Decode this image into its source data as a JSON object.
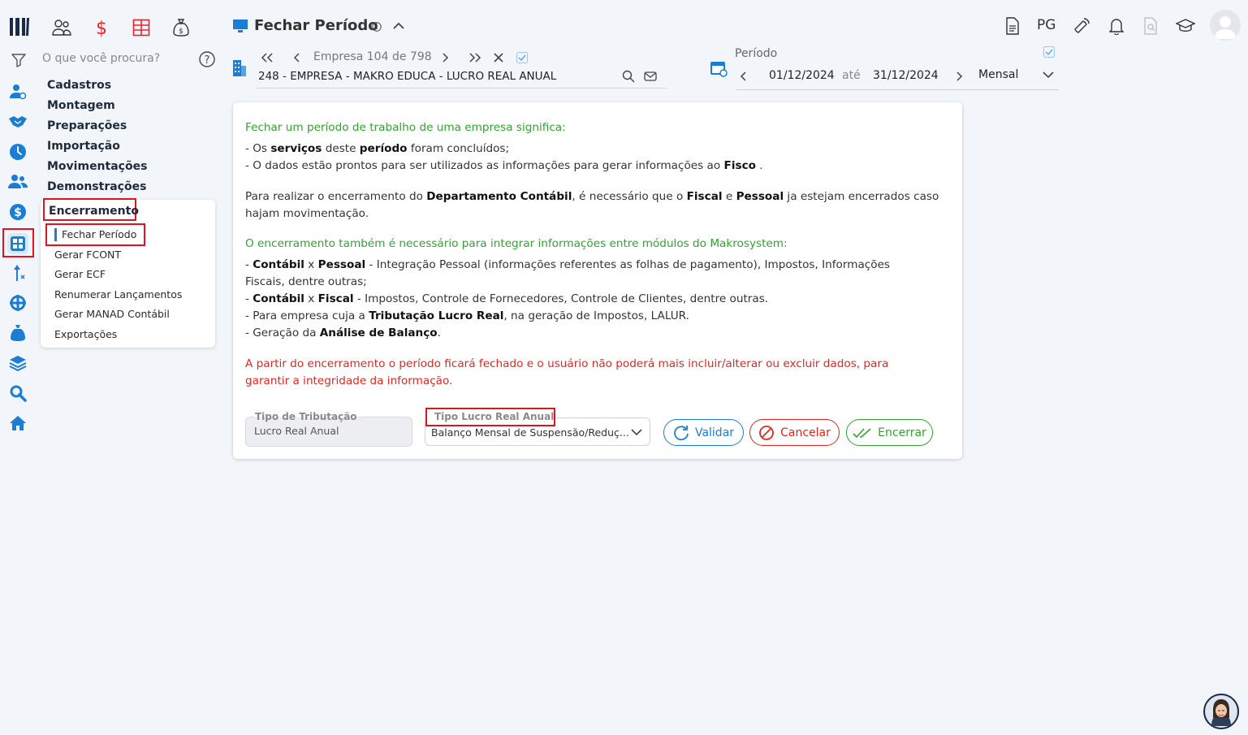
{
  "search": {
    "placeholder": "O que você procura?"
  },
  "header": {
    "title": "Fechar Período",
    "right_text": "PG"
  },
  "company": {
    "prefix": "Empresa",
    "current": "104",
    "of": "de",
    "total": "798",
    "name": "248 - EMPRESA - MAKRO EDUCA - LUCRO REAL ANUAL"
  },
  "period": {
    "label": "Período",
    "start": "01/12/2024",
    "between": "até",
    "end": "31/12/2024",
    "mode": "Mensal"
  },
  "menu": {
    "items": [
      "Cadastros",
      "Montagem",
      "Preparações",
      "Importação",
      "Movimentações",
      "Demonstrações"
    ],
    "group": "Encerramento",
    "subitems": [
      "Fechar Período",
      "Gerar FCONT",
      "Gerar ECF",
      "Renumerar Lançamentos",
      "Gerar MANAD Contábil",
      "Exportações"
    ]
  },
  "content": {
    "intro": "Fechar um período de trabalho de uma empresa significa:",
    "l1": {
      "a": "- Os ",
      "b": "serviços",
      "c": " deste ",
      "d": "período",
      "e": " foram concluídos;"
    },
    "l2": {
      "a": "- O dados estão prontos para ser utilizados as informações para gerar informações ao ",
      "b": "Fisco",
      "c": " ."
    },
    "p2": {
      "a": "Para realizar o encerramento do ",
      "b": "Departamento Contábil",
      "c": ", é necessário que o ",
      "d": "Fiscal",
      "e": " e ",
      "f": "Pessoal",
      "g": " ja estejam encerrados caso"
    },
    "p2b": "hajam movimentação.",
    "integ": "O encerramento também é necessário para integrar informações entre módulos do Makrosystem:",
    "i1": {
      "a": "- ",
      "b": "Contábil",
      "c": " x ",
      "d": "Pessoal",
      "e": " - Integração Pessoal (informações referentes as folhas de pagamento), Impostos, Informações"
    },
    "i1b": "Fiscais, dentre outras;",
    "i2": {
      "a": "- ",
      "b": "Contábil",
      "c": " x ",
      "d": "Fiscal",
      "e": " - Impostos, Controle de Fornecedores, Controle de Clientes, dentre outras."
    },
    "i3": {
      "a": "- Para empresa cuja a ",
      "b": "Tributação Lucro Real",
      "c": ", na geração de Impostos, LALUR."
    },
    "i4": {
      "a": "- Geração da ",
      "b": "Análise de Balanço",
      "c": "."
    },
    "warn1": "A partir do encerramento o período ficará fechado e o usuário não poderá mais incluir/alterar ou excluir dados, para",
    "warn2": "garantir a integridade da informação."
  },
  "form": {
    "tributacao": {
      "label": "Tipo de Tributação",
      "value": "Lucro Real Anual"
    },
    "lucro": {
      "label": "Tipo Lucro Real Anual",
      "value": "Balanço Mensal de Suspensão/Reduç..."
    }
  },
  "buttons": {
    "validar": "Validar",
    "cancelar": "Cancelar",
    "encerrar": "Encerrar"
  },
  "colors": {
    "primary": "#1a7fd4",
    "green": "#2fa52f",
    "red": "#e5261f",
    "highlight": "#e0141e"
  }
}
